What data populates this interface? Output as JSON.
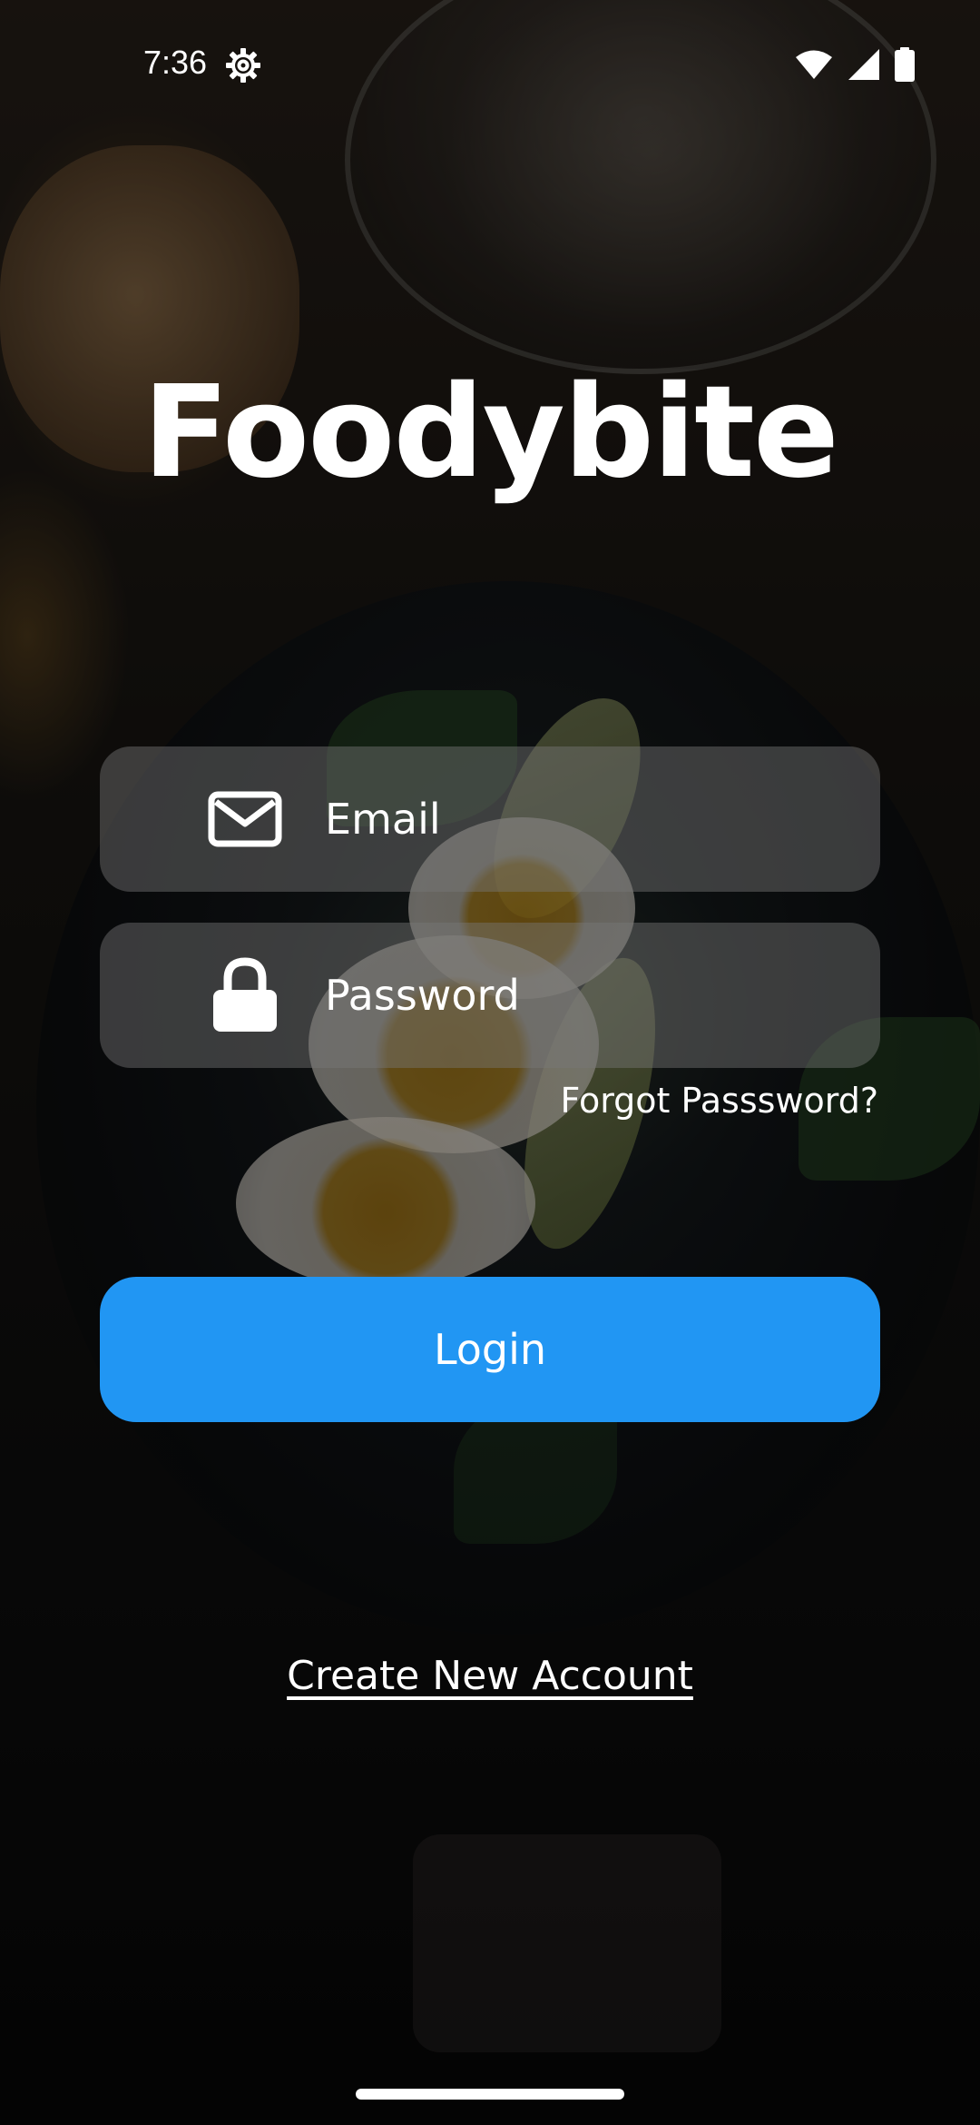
{
  "status_bar": {
    "time": "7:36",
    "icons": [
      "settings-icon",
      "wifi-icon",
      "signal-icon",
      "battery-icon"
    ]
  },
  "app": {
    "title": "Foodybite"
  },
  "login_form": {
    "email": {
      "placeholder": "Email",
      "value": "",
      "icon": "mail-icon"
    },
    "password": {
      "placeholder": "Password",
      "value": "",
      "icon": "lock-icon"
    },
    "forgot_label": "Forgot Passsword?",
    "login_label": "Login",
    "create_account_label": "Create New Account"
  },
  "colors": {
    "accent": "#2196F3",
    "text": "#FFFFFF",
    "field_background": "rgba(120,120,120,0.45)"
  }
}
